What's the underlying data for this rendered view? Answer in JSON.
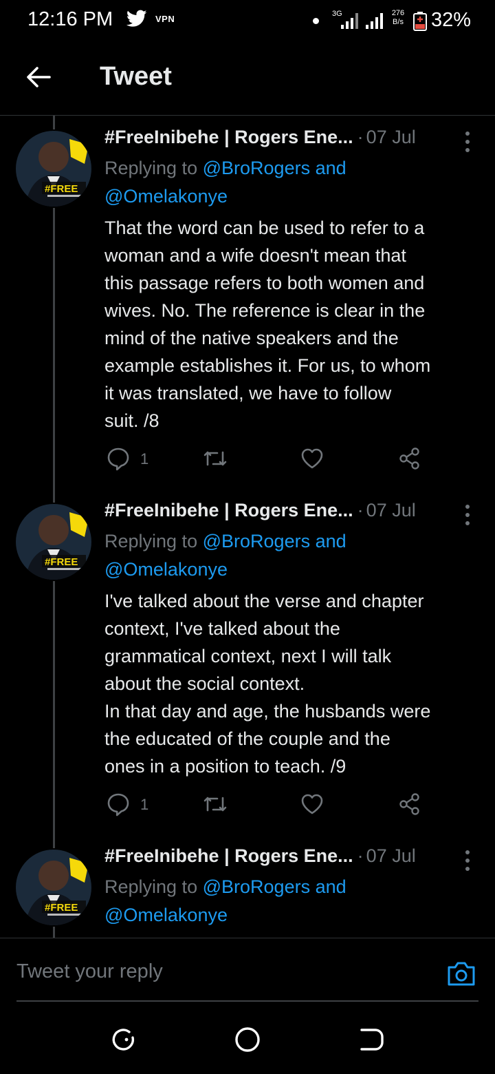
{
  "status_bar": {
    "time": "12:16 PM",
    "vpn": "VPN",
    "network": "3G",
    "speed_value": "276",
    "speed_unit": "B/s",
    "battery": "32%"
  },
  "header": {
    "title": "Tweet"
  },
  "tweets": [
    {
      "author": "#FreeInibehe | Rogers Ene...",
      "date": "07 Jul",
      "replying_prefix": "Replying to",
      "mention_1": "@BroRogers and",
      "mention_2": "@Omelakonye",
      "body": "That the word can be used to refer to a\nwoman and a wife doesn't mean that\nthis passage refers to both women and\nwives. No. The reference is clear in the\nmind of the native speakers and the\nexample establishes it. For us, to whom\nit was translated, we have to follow\nsuit. /8",
      "reply_count": "1",
      "avatar_badge": "#FREE"
    },
    {
      "author": "#FreeInibehe | Rogers Ene...",
      "date": "07 Jul",
      "replying_prefix": "Replying to",
      "mention_1": "@BroRogers and",
      "mention_2": "@Omelakonye",
      "body": "I've talked about the verse and chapter\ncontext, I've talked about the\ngrammatical context, next I will talk\nabout the social context.\nIn that day and age, the husbands were\nthe educated of the couple and the\nones in a position to teach. /9",
      "reply_count": "1",
      "avatar_badge": "#FREE"
    },
    {
      "author": "#FreeInibehe | Rogers Ene...",
      "date": "07 Jul",
      "replying_prefix": "Replying to",
      "mention_1": "@BroRogers and",
      "mention_2": "@Omelakonye",
      "avatar_badge": "#FREE"
    }
  ],
  "reply_bar": {
    "placeholder": "Tweet your reply"
  },
  "colors": {
    "background": "#000000",
    "text": "#e7e9ea",
    "muted": "#71767b",
    "link": "#1d9bf0",
    "badge": "#f5d90a"
  }
}
